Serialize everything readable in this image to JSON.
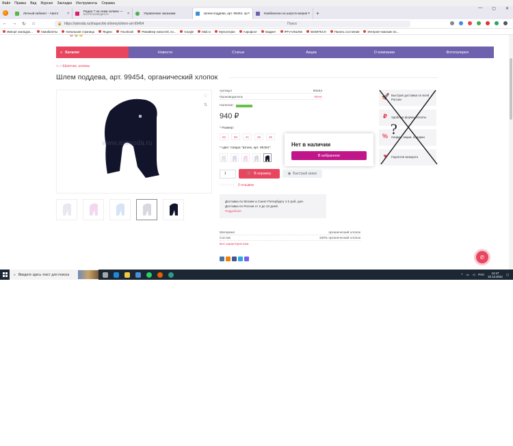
{
  "browser": {
    "menu": [
      "Файл",
      "Правка",
      "Вид",
      "Журнал",
      "Закладки",
      "Инструменты",
      "Справка"
    ],
    "tabs": [
      {
        "title": "Личный кабинет - Авито",
        "sub": "",
        "fav_color": "#59b54b",
        "active": false
      },
      {
        "title": "Радио 7 на семи холмах —",
        "sub": "ВОСПРОИЗВОДИТСЯ",
        "fav_color": "#d81e6b",
        "active": false
      },
      {
        "title": "Управление заказами",
        "sub": "",
        "fav_color": "#4caf50",
        "active": false
      },
      {
        "title": "Шлем поддева, арт. 99454, ор",
        "sub": "",
        "fav_color": "#3f8fd1",
        "active": true
      },
      {
        "title": "Комбинезон из шерсти мерин",
        "sub": "",
        "fav_color": "#6e61ae",
        "active": false
      }
    ],
    "url": "https://aimoda.ru/shapochki-shlemy/shlem-art-99454",
    "search_placeholder": "Поиск",
    "bookmarks": [
      "Импорт закладок...",
      "Авиабилеты",
      "Начальная страница",
      "Яндекс",
      "Facebook",
      "Ремайнер новостей, по...",
      "Google",
      "Mail.ru",
      "Мультитран",
      "Аэрофлот",
      "Бюджет",
      "IPTV-ONLINE",
      "BGMITECH",
      "Панель состояния",
      "Интернет-магазин по..."
    ]
  },
  "nav": {
    "catalog": "Каталог",
    "items": [
      "Новости",
      "Статьи",
      "Акции",
      "О компании",
      "Фотогалерея"
    ]
  },
  "breadcrumb": {
    "sep": ">",
    "item": "Шапочки, шлемы"
  },
  "product": {
    "title": "Шлем поддева, арт. 99454, органический хлопок",
    "watermark": "www.aximoda.ru",
    "article_label": "Артикул",
    "article_value": "99454",
    "maker_label": "Производитель",
    "maker_value": "ЮНА",
    "availability_label": "Наличие:",
    "price": "940 ₽",
    "size_label": "* Размер:",
    "sizes": [
      "52",
      "50",
      "41",
      "48",
      "45"
    ],
    "color_label": "* Цвет товара \"Шлем, арт. 99454\":",
    "qty": "1",
    "cart_button": "В корзину",
    "quick_order": "Быстрый заказ",
    "reviews": "0 отзывов",
    "stars": "☆☆☆☆☆",
    "delivery_line1": "Доставка по Москве и Санкт-Петербургу 1-2 раб. дня.",
    "delivery_line2": "Доставка по России от 2 до 10 дней.",
    "delivery_more": "Подробнее",
    "specs": [
      {
        "label": "Материал",
        "value": "органический хлопок"
      },
      {
        "label": "Состав",
        "value": "100% органический хлопок"
      }
    ],
    "all_specs": "Все характеристики"
  },
  "popup": {
    "heading": "Нет в наличии",
    "button": "В избранное"
  },
  "features": [
    {
      "icon": "🚀",
      "text": "Быстрая доставка по всей России"
    },
    {
      "icon": "₽",
      "text": "Удобные формы оплаты"
    },
    {
      "icon": "%",
      "text": "Скидки, акции, подарки"
    },
    {
      "icon": "♥",
      "text": "Гарантия возврата"
    }
  ],
  "taskbar": {
    "search_placeholder": "Введите здесь текст для поиска",
    "lang": "РУС",
    "time": "14:47",
    "date": "22.12.2022"
  },
  "colors": {
    "accent_pink": "#e8465f",
    "nav_purple": "#6e61ae",
    "popup_button": "#c1168a"
  }
}
